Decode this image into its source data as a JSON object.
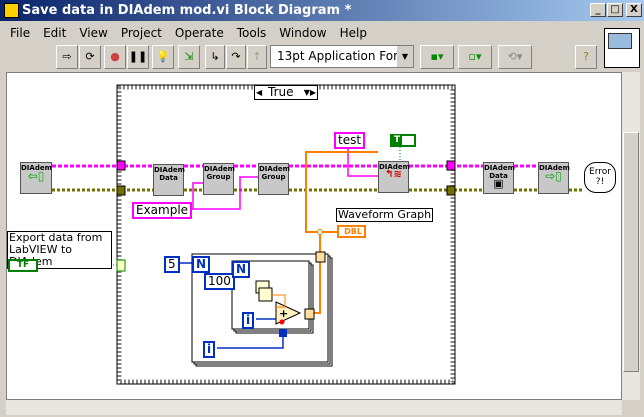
{
  "window": {
    "title": "Save data in DIAdem mod.vi Block Diagram *",
    "controls": [
      "_",
      "□",
      "X"
    ]
  },
  "menu": [
    "File",
    "Edit",
    "View",
    "Project",
    "Operate",
    "Tools",
    "Window",
    "Help"
  ],
  "toolbar": {
    "font": "13pt Application Font",
    "help": "?"
  },
  "diagram": {
    "case_selector": "True",
    "nodes": {
      "open": "DIAdem",
      "data": "DIAdem Data",
      "group_create": "DIAdem Group",
      "group_get": "DIAdem Group",
      "graph": "DIAdem",
      "save": "DIAdem Data",
      "close": "DIAdem",
      "error": "Error ?!"
    },
    "constants": {
      "test": "test",
      "example": "Example",
      "bool_true": "T",
      "n_outer": "5",
      "n_inner": "100",
      "loop_n": "N",
      "loop_i": "i",
      "dbl": "DBL",
      "tf": "TF"
    },
    "labels": {
      "waveform_graph": "Waveform Graph",
      "export": "Export data from LabVIEW to DIAdem"
    }
  },
  "colors": {
    "string_wire": "#ff00ff",
    "refnum_wire": "#808000",
    "numeric_wire": "#ff8000",
    "int_wire": "#0030c0",
    "bool_wire": "#008000"
  }
}
